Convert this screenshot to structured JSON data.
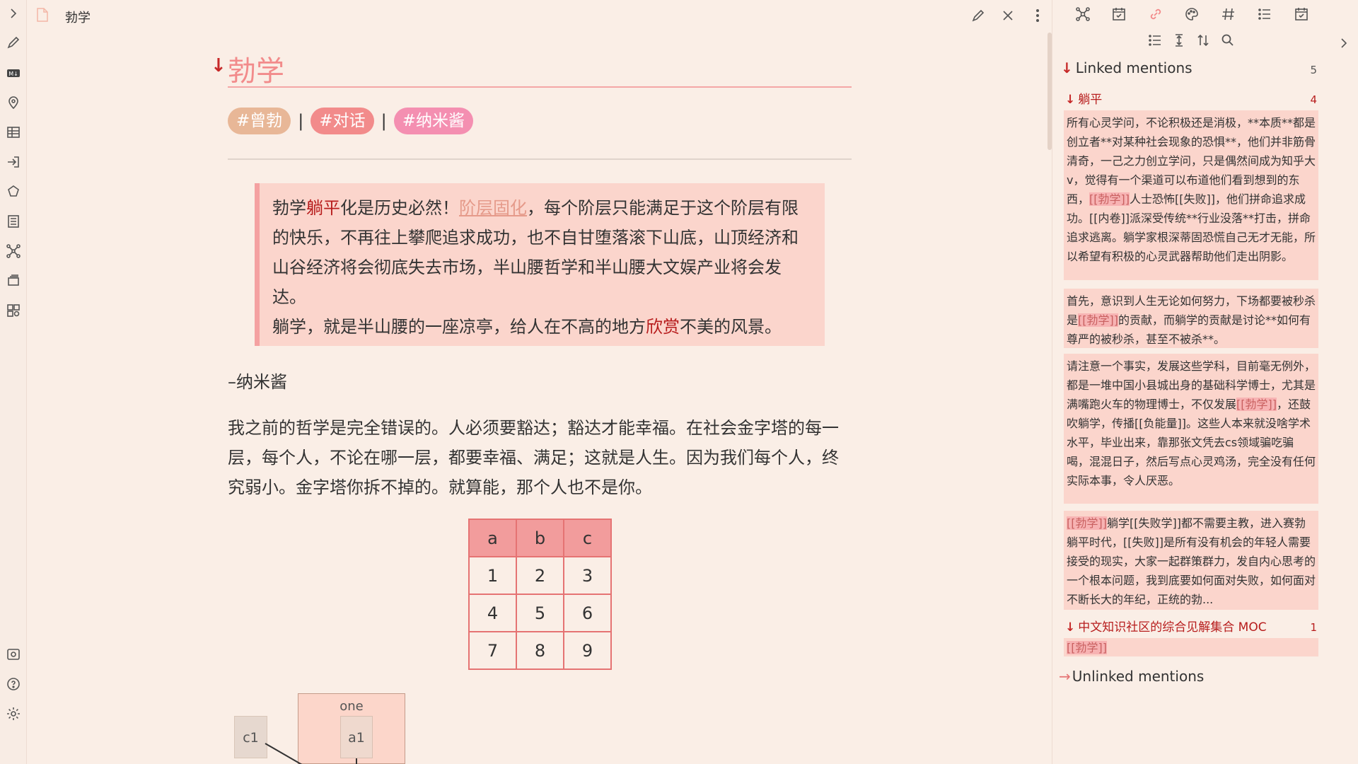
{
  "window": {
    "tab_title": "勃学"
  },
  "note": {
    "heading": "勃学",
    "heading_arrow": "↓",
    "tags": [
      {
        "label": "#曾勃",
        "color": "#e8b797"
      },
      {
        "label": "#对话",
        "color": "#f28b8b"
      },
      {
        "label": "#纳米酱",
        "color": "#f48fb1"
      }
    ],
    "tag_separator": "|",
    "quote": {
      "line1_a": "勃学",
      "line1_b": "躺平",
      "line1_c": "化是历史必然！",
      "line1_link": "阶层固化",
      "line1_d": "，每个阶层只能满足于这个阶层有限的快乐，不再往上攀爬追求成功，也不自甘堕落滚下山底，山顶经济和山谷经济将会彻底失去市场，半山腰哲学和半山腰大文娱产业将会发达。",
      "line2_a": "躺学，就是半山腰的一座凉亭，给人在不高的地方",
      "line2_b": "欣赏",
      "line2_c": "不美的风景。"
    },
    "author": "–纳米酱",
    "paragraph": "我之前的哲学是完全错误的。人必须要豁达；豁达才能幸福。在社会金字塔的每一层，每个人，不论在哪一层，都要幸福、满足；这就是人生。因为我们每个人，终究弱小。金字塔你拆不掉的。就算能，那个人也不是你。",
    "table": {
      "headers": [
        "a",
        "b",
        "c"
      ],
      "rows": [
        [
          "1",
          "2",
          "3"
        ],
        [
          "4",
          "5",
          "6"
        ],
        [
          "7",
          "8",
          "9"
        ]
      ]
    },
    "diagram": {
      "c1": "c1",
      "one": "one",
      "a1": "a1"
    }
  },
  "backlinks": {
    "linked_title": "Linked mentions",
    "linked_count": "5",
    "groups": [
      {
        "file": "躺平",
        "count": "4",
        "snippets": [
          {
            "parts": [
              "所有心灵学问，不论积极还是消极，**本质**都是创立者**对某种社会现象的恐惧**，他们并非筋骨清奇，一己之力创立学问，只是偶然间成为知乎大v，觉得有一个渠道可以布道他们看到想到的东西，",
              "[[勃学]]",
              "人士恐怖[[失败]]，他们拼命追求成功。[[内卷]]派深受传统**行业没落**打击，拼命追求逃离。躺学家根深蒂固恐慌自己无才无能，所以希望有积极的心灵武器帮助他们走出阴影。"
            ]
          },
          {
            "parts": [
              "首先，意识到人生无论如何努力，下场都要被秒杀是",
              "[[勃学]]",
              "的贡献，而躺学的贡献是讨论**如何有尊严的被秒杀，甚至不被杀**。"
            ]
          },
          {
            "parts": [
              "请注意一个事实，发展这些学科，目前毫无例外，都是一堆中国小县城出身的基础科学博士，尤其是满嘴跑火车的物理博士，不仅发展",
              "[[勃学]]",
              "，还鼓吹躺学，传播[[负能量]]。这些人本来就没啥学术水平，毕业出来，靠那张文凭去cs领域骗吃骗喝，混混日子，然后写点心灵鸡汤，完全没有任何实际本事，令人厌恶。"
            ]
          },
          {
            "parts": [
              "",
              "[[勃学]]",
              "躺学[[失败学]]都不需要主教，进入赛勃躺平时代，[[失败]]是所有没有机会的年轻人需要接受的现实，大家一起群策群力，发自内心思考的一个根本问题，我到底要如何面对失败，如何面对不断长大的年纪，正统的勃..."
            ]
          }
        ]
      },
      {
        "file": "中文知识社区的综合见解集合 MOC",
        "count": "1",
        "snippets": [
          {
            "parts": [
              "",
              "[[勃学]]",
              ""
            ]
          }
        ]
      }
    ],
    "unlinked_title": "Unlinked mentions"
  }
}
